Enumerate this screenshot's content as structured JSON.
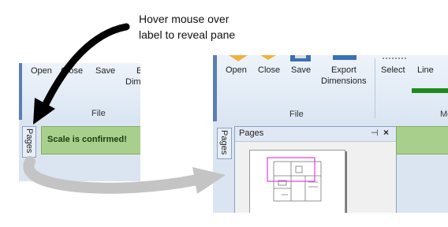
{
  "caption": {
    "line1": "Hover mouse over",
    "line2": "label to reveal pane"
  },
  "left": {
    "buttons": [
      "Open",
      "Close",
      "Save",
      "E",
      "Dim"
    ],
    "section": "File",
    "tab": "Pages",
    "message": "Scale is confirmed!"
  },
  "right": {
    "buttons": [
      "Open",
      "Close",
      "Save",
      "Export",
      "Dimensions",
      "Select",
      "Line"
    ],
    "section1": "File",
    "section2": "Me",
    "tab": "Pages",
    "pane": {
      "title": "Pages",
      "pin": "⊣",
      "close": "×"
    }
  },
  "colors": {
    "accent_blue": "#5a7fb5",
    "message_green": "#a9cf8d",
    "highlight_magenta": "#e040e0",
    "line_green": "#1d8a1d"
  }
}
